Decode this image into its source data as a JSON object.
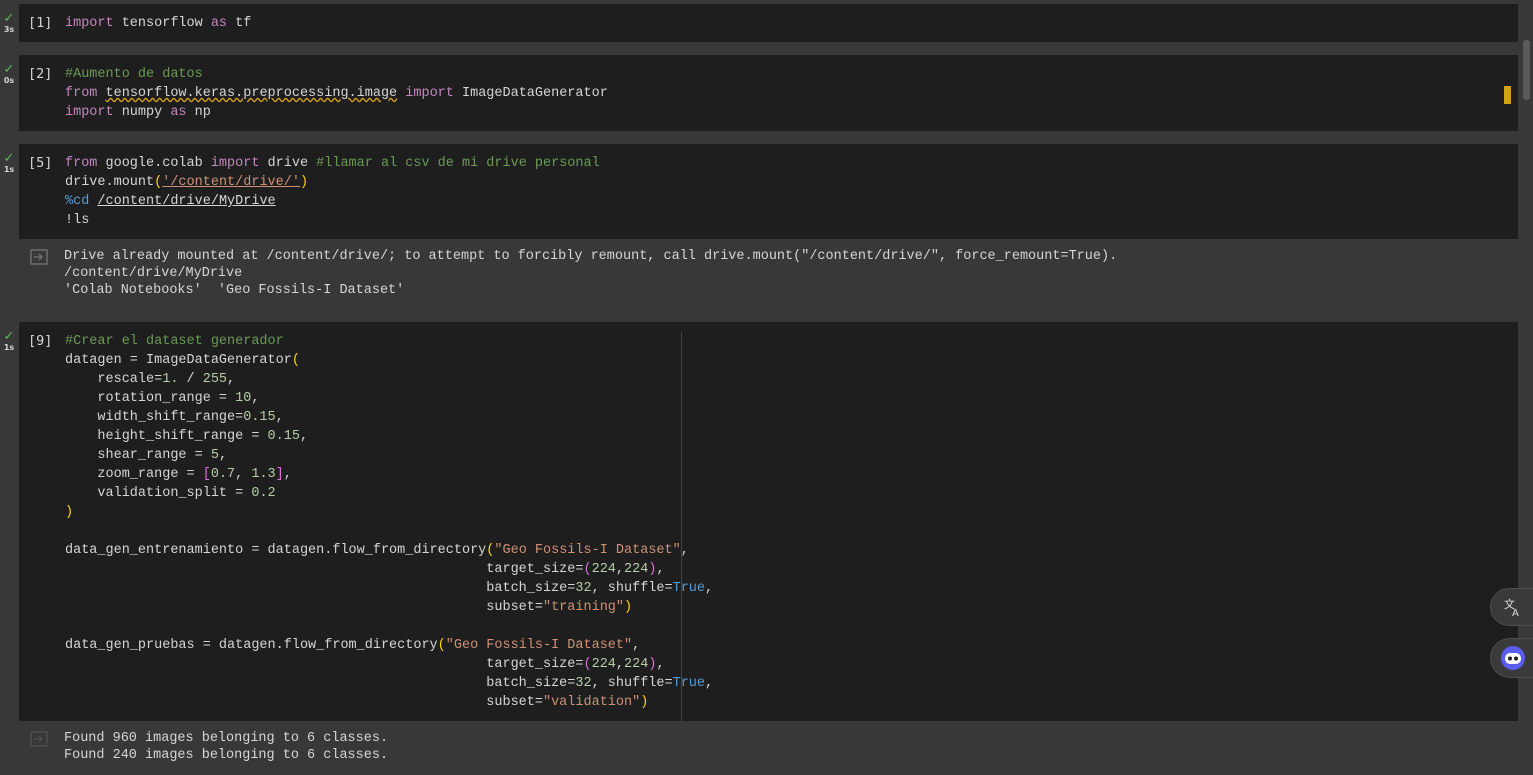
{
  "cells": [
    {
      "count": "[1]",
      "duration": "3s"
    },
    {
      "count": "[2]",
      "duration": "0s"
    },
    {
      "count": "[5]",
      "duration": "1s"
    },
    {
      "count": "[9]",
      "duration": "1s"
    }
  ],
  "cell1": {
    "import_kw": "import",
    "module": " tensorflow ",
    "as_kw": "as",
    "alias": " tf"
  },
  "cell2": {
    "comment": "#Aumento de datos",
    "from_kw": "from",
    "module": "tensorflow.keras.preprocessing.image",
    "import_kw": "import",
    "name": " ImageDataGenerator",
    "import_kw2": "import",
    "module2": " numpy ",
    "as_kw": "as",
    "alias": " np"
  },
  "cell3": {
    "from_kw": "from",
    "module": " google.colab ",
    "import_kw": "import",
    "name": " drive ",
    "comment": "#llamar al csv de mi drive personal",
    "mount_call": "drive.mount",
    "open_paren": "(",
    "path_str": "'/content/drive/'",
    "close_paren": ")",
    "magic": "%cd",
    "cd_path": "/content/drive/MyDrive",
    "shell": "!ls"
  },
  "output3": {
    "lines": [
      "Drive already mounted at /content/drive/; to attempt to forcibly remount, call drive.mount(\"/content/drive/\", force_remount=True).",
      "/content/drive/MyDrive",
      "'Colab Notebooks'  'Geo Fossils-I Dataset'"
    ]
  },
  "cell4": {
    "comment": "#Crear el dataset generador",
    "l2a": "datagen = ImageDataGenerator",
    "l2b": "(",
    "l3a": "    rescale=",
    "l3b": "1.",
    "l3c": " / ",
    "l3d": "255",
    "l3e": ",",
    "l4a": "    rotation_range = ",
    "l4b": "10",
    "l4c": ",",
    "l5a": "    width_shift_range=",
    "l5b": "0.15",
    "l5c": ",",
    "l6a": "    height_shift_range = ",
    "l6b": "0.15",
    "l6c": ",",
    "l7a": "    shear_range = ",
    "l7b": "5",
    "l7c": ",",
    "l8a": "    zoom_range = ",
    "l8b": "[",
    "l8c": "0.7",
    "l8d": ", ",
    "l8e": "1.3",
    "l8f": "]",
    "l8g": ",",
    "l9a": "    validation_split = ",
    "l9b": "0.2",
    "l10": ")",
    "l12a": "data_gen_entrenamiento = datagen.flow_from_directory",
    "l12b": "(",
    "l12c": "\"Geo Fossils-I Dataset\"",
    "l12d": ",",
    "l13a": "                                                    target_size=",
    "l13b": "(",
    "l13c": "224",
    "l13d": ",",
    "l13e": "224",
    "l13f": ")",
    "l13g": ",",
    "l14a": "                                                    batch_size=",
    "l14b": "32",
    "l14c": ", shuffle=",
    "l14d": "True",
    "l14e": ",",
    "l15a": "                                                    subset=",
    "l15b": "\"training\"",
    "l15c": ")",
    "l17a": "data_gen_pruebas = datagen.flow_from_directory",
    "l17b": "(",
    "l17c": "\"Geo Fossils-I Dataset\"",
    "l17d": ",",
    "l18a": "                                                    target_size=",
    "l18b": "(",
    "l18c": "224",
    "l18d": ",",
    "l18e": "224",
    "l18f": ")",
    "l18g": ",",
    "l19a": "                                                    batch_size=",
    "l19b": "32",
    "l19c": ", shuffle=",
    "l19d": "True",
    "l19e": ",",
    "l20a": "                                                    subset=",
    "l20b": "\"validation\"",
    "l20c": ")"
  },
  "output4": {
    "lines": [
      "Found 960 images belonging to 6 classes.",
      "Found 240 images belonging to 6 classes."
    ]
  },
  "icons": {
    "run_check": "check-icon",
    "output_toggle": "output-icon",
    "translate": "translate-icon",
    "assistant": "assistant-icon"
  },
  "colors": {
    "keyword": "#c586c0",
    "comment": "#6a9955",
    "string": "#ce9178",
    "number": "#b5cea8",
    "constant": "#569cd6",
    "bracket": "#ffd700",
    "success": "#5cb85c"
  }
}
